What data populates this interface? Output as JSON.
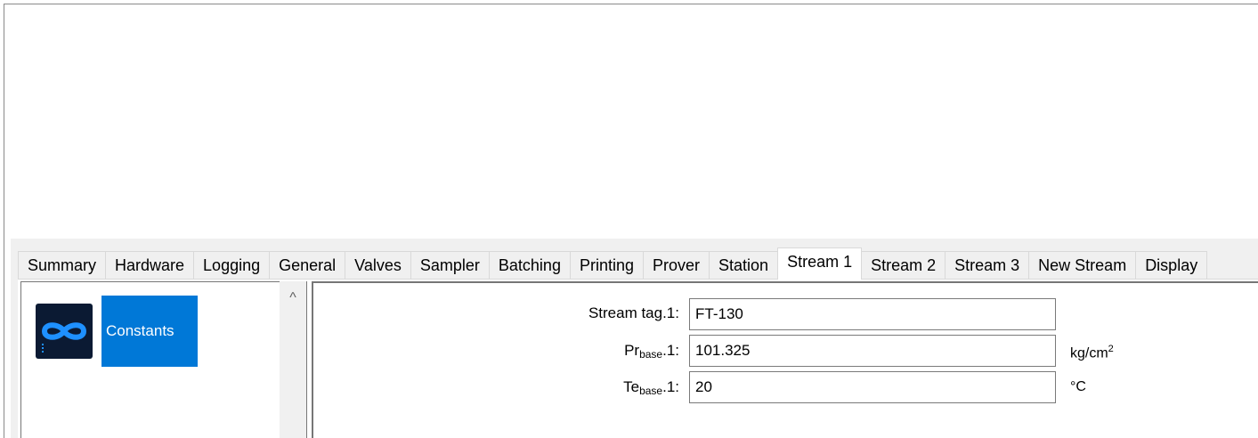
{
  "tabs": [
    {
      "label": "Summary"
    },
    {
      "label": "Hardware"
    },
    {
      "label": "Logging"
    },
    {
      "label": "General"
    },
    {
      "label": "Valves"
    },
    {
      "label": "Sampler"
    },
    {
      "label": "Batching"
    },
    {
      "label": "Printing"
    },
    {
      "label": "Prover"
    },
    {
      "label": "Station"
    },
    {
      "label": "Stream 1",
      "active": true
    },
    {
      "label": "Stream 2"
    },
    {
      "label": "Stream 3"
    },
    {
      "label": "New Stream"
    },
    {
      "label": "Display"
    }
  ],
  "left_panel": {
    "app_icon": "infinity-logo-icon",
    "tile_label": "Constants",
    "scroll_up_glyph": "^"
  },
  "fields": {
    "stream_tag": {
      "label": "Stream tag.1:",
      "value": "FT-130"
    },
    "pr_base": {
      "label_prefix": "Pr",
      "label_sub": "base",
      "label_suffix": ".1:",
      "value": "101.325",
      "unit": "kg/cm",
      "unit_sup": "2"
    },
    "te_base": {
      "label_prefix": "Te",
      "label_sub": "base",
      "label_suffix": ".1:",
      "value": "20",
      "unit": "°C"
    }
  },
  "colors": {
    "accent_tile": "#0078d7",
    "app_icon_bg": "#0b1a33",
    "panel_bg": "#f0f0f0"
  }
}
